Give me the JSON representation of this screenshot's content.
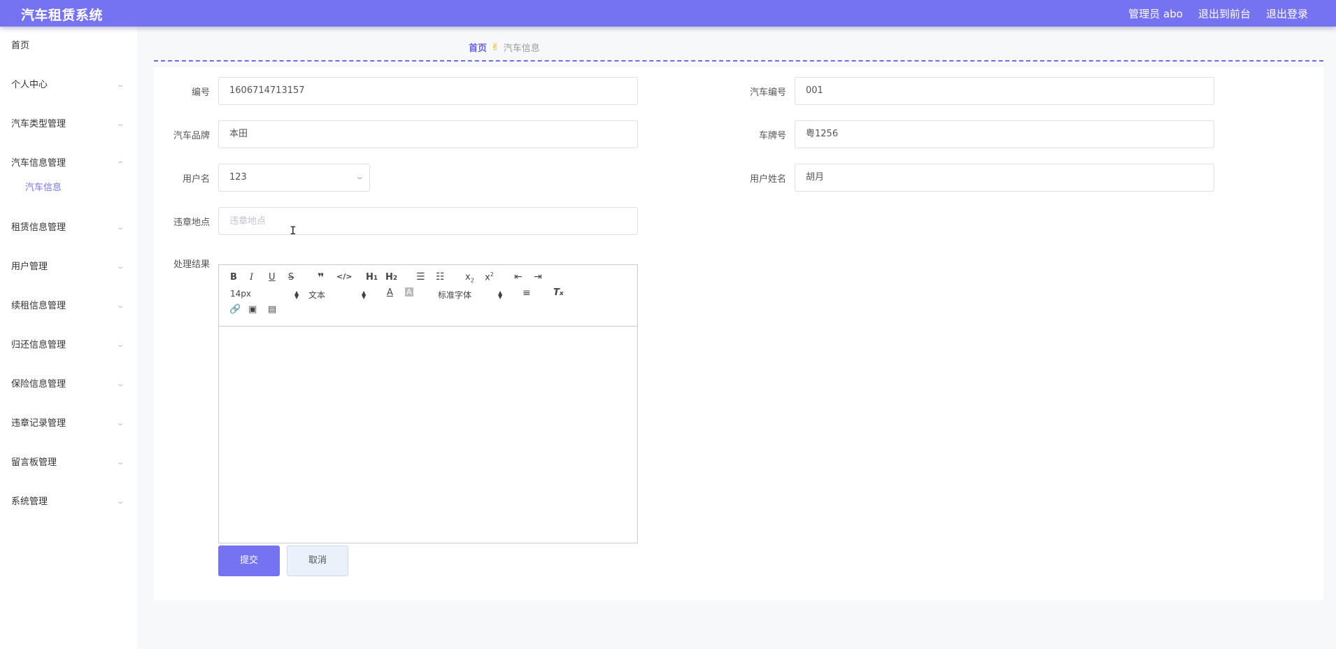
{
  "app": {
    "title": "汽车租赁系统",
    "user_label": "管理员 abo",
    "front_link": "退出到前台",
    "logout_link": "退出登录"
  },
  "sidebar": {
    "items": [
      {
        "label": "首页"
      },
      {
        "label": "个人中心"
      },
      {
        "label": "汽车类型管理"
      },
      {
        "label": "汽车信息管理",
        "expanded": true,
        "children": [
          {
            "label": "汽车信息"
          }
        ]
      },
      {
        "label": "租赁信息管理"
      },
      {
        "label": "用户管理"
      },
      {
        "label": "续租信息管理"
      },
      {
        "label": "归还信息管理"
      },
      {
        "label": "保险信息管理"
      },
      {
        "label": "违章记录管理"
      },
      {
        "label": "留言板管理"
      },
      {
        "label": "系统管理"
      }
    ]
  },
  "breadcrumb": {
    "home": "首页",
    "current": "汽车信息"
  },
  "form": {
    "id_label": "编号",
    "id_value": "1606714713157",
    "car_no_label": "汽车编号",
    "car_no_value": "001",
    "brand_label": "汽车品牌",
    "brand_value": "本田",
    "plate_label": "车牌号",
    "plate_value": "粤1256",
    "username_label": "用户名",
    "username_value": "123",
    "realname_label": "用户姓名",
    "realname_value": "胡月",
    "location_label": "违章地点",
    "location_placeholder": "违章地点",
    "result_label": "处理结果"
  },
  "editor": {
    "font_size": "14px",
    "header_type": "文本",
    "font_family": "标准字体"
  },
  "buttons": {
    "submit": "提交",
    "cancel": "取消"
  },
  "colors": {
    "primary": "#7673f3",
    "breadcrumb_home": "#6563e8",
    "background": "#f7f8fa"
  }
}
